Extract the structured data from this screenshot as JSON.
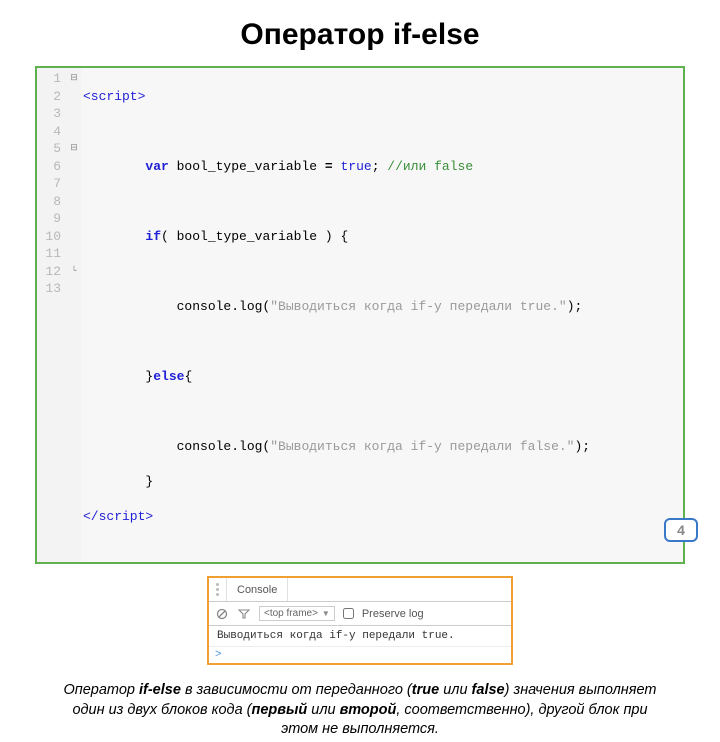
{
  "title": "Оператор if-else",
  "code": {
    "lines": [
      "1",
      "2",
      "3",
      "4",
      "5",
      "6",
      "7",
      "8",
      "9",
      "10",
      "11",
      "12",
      "13"
    ],
    "fold": {
      "l1": "⊟",
      "l5": "⊟",
      "l12": "└"
    },
    "c": {
      "script_open": "<script>",
      "script_close": "</script>",
      "var": "var",
      "ident": " bool_type_variable ",
      "eq": "=",
      "true_lit": " true",
      "semi": ";",
      "comment": " //или false",
      "if": "if",
      "if_cond": "( bool_type_variable ) {",
      "log1a": "            console.log(",
      "str1": "\"Выводиться когда if-у передали true.\"",
      "log_close": ");",
      "else_line": "        }",
      "else_kw": "else",
      "else_open": "{",
      "log2a": "            console.log(",
      "str2": "\"Выводиться когда if-y передали false.\"",
      "close_brace": "        }"
    }
  },
  "console": {
    "tab": "Console",
    "dropdown": "<top frame>",
    "preserve": "Preserve log",
    "output": "Выводиться когда if-у передали true.",
    "prompt": ">"
  },
  "description": {
    "p1": "Оператор ",
    "b1": "if-else",
    "p2": " в зависимости от переданного (",
    "b2": "true",
    "p3": " или ",
    "b3": "false",
    "p4": ") значения выполняет один из двух блоков кода (",
    "b4": "первый",
    "p5": " или ",
    "b5": "второй",
    "p6": ", соответственно), другой блок при этом не выполняется."
  },
  "page": "4"
}
